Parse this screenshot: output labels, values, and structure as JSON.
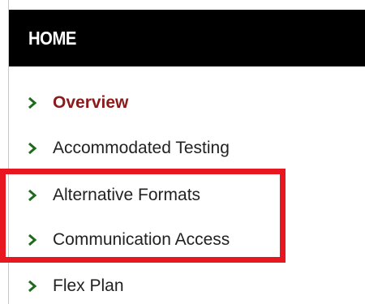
{
  "header": {
    "title": "HOME"
  },
  "nav": {
    "items": [
      {
        "label": "Overview",
        "active": true
      },
      {
        "label": "Accommodated Testing",
        "active": false
      },
      {
        "label": "Alternative Formats",
        "active": false
      },
      {
        "label": "Communication Access",
        "active": false
      },
      {
        "label": "Flex Plan",
        "active": false
      }
    ]
  },
  "icons": {
    "nav_item_icon": "chevron-right-icon"
  },
  "colors": {
    "header_bg": "#000000",
    "header_text": "#ffffff",
    "active_text": "#8b1a1a",
    "chevron": "#1e6b1e",
    "highlight": "#e8161f"
  }
}
